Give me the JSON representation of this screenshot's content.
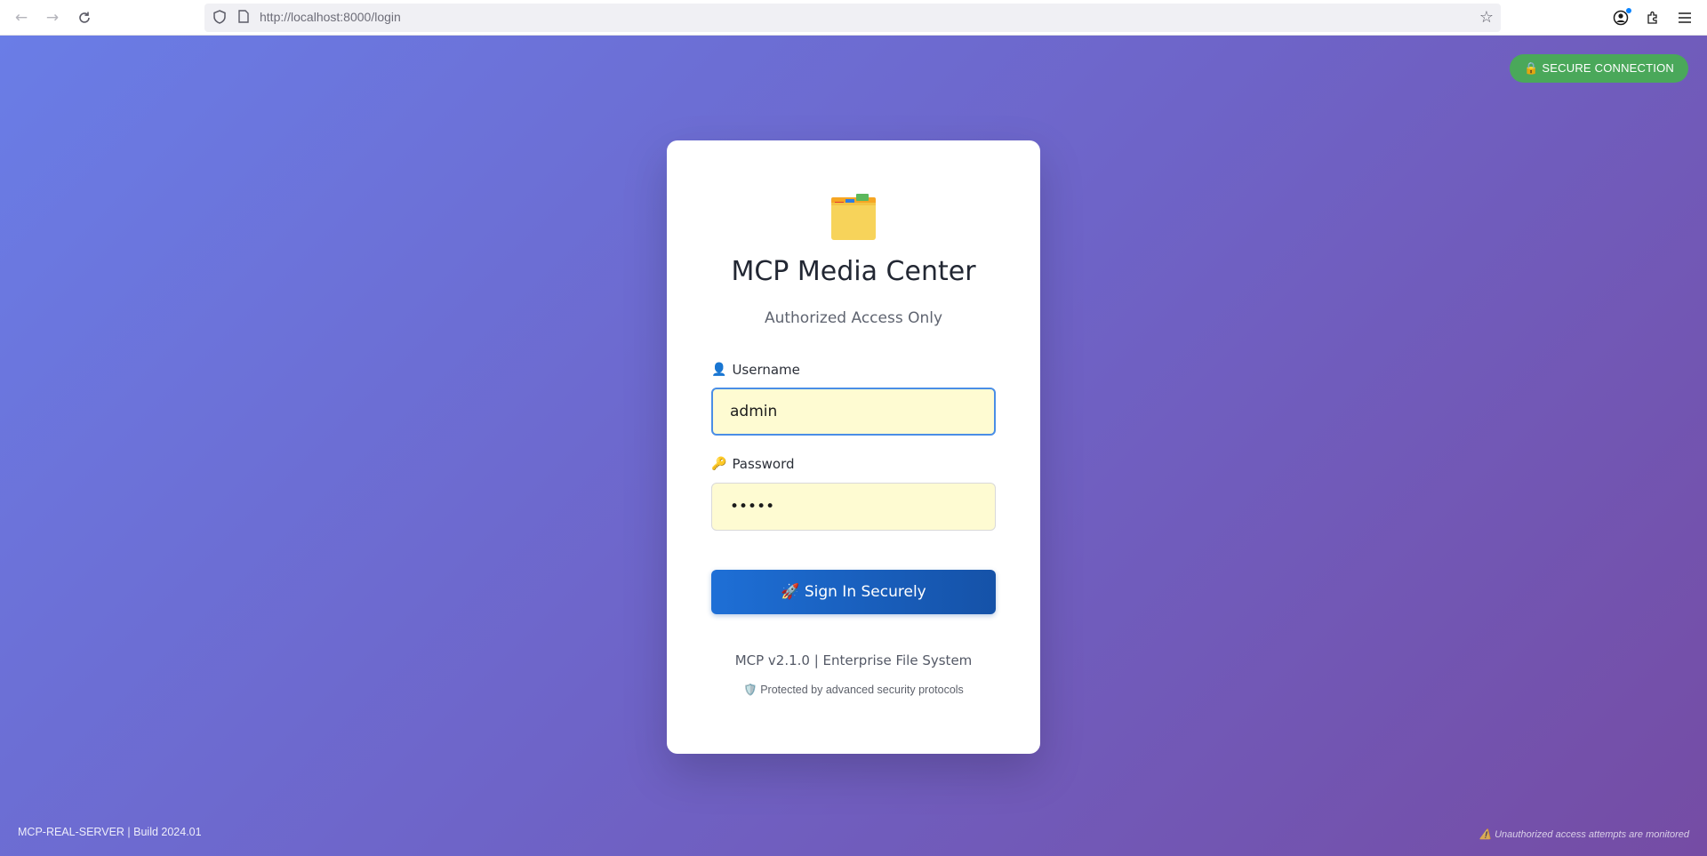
{
  "browser": {
    "url_host": "http://localhost",
    "url_rest": ":8000/login",
    "icons": [
      "back-icon",
      "forward-icon",
      "reload-icon",
      "shield-icon",
      "page-icon",
      "star-icon",
      "account-icon",
      "extensions-icon",
      "menu-icon"
    ]
  },
  "badge": {
    "text": "🔒 SECURE CONNECTION"
  },
  "login": {
    "logo": "folder-icon",
    "title": "MCP Media Center",
    "subtitle": "Authorized Access Only",
    "username_label": "Username",
    "username_icon": "👤",
    "username_value": "admin",
    "password_label": "Password",
    "password_icon": "🔑",
    "password_value": "•••••",
    "submit_label": "🚀 Sign In Securely",
    "version": "MCP v2.1.0 | Enterprise File System",
    "protected": "🛡️ Protected by advanced security protocols"
  },
  "footer": {
    "left": "MCP-REAL-SERVER | Build 2024.01",
    "right": "⚠️ Unauthorized access attempts are monitored"
  },
  "colors": {
    "badge_bg": "#4aa85a",
    "button_start": "#1e6fd6",
    "button_end": "#1552a8",
    "input_bg": "#fefbd2",
    "focus_border": "#4a8ee6"
  }
}
